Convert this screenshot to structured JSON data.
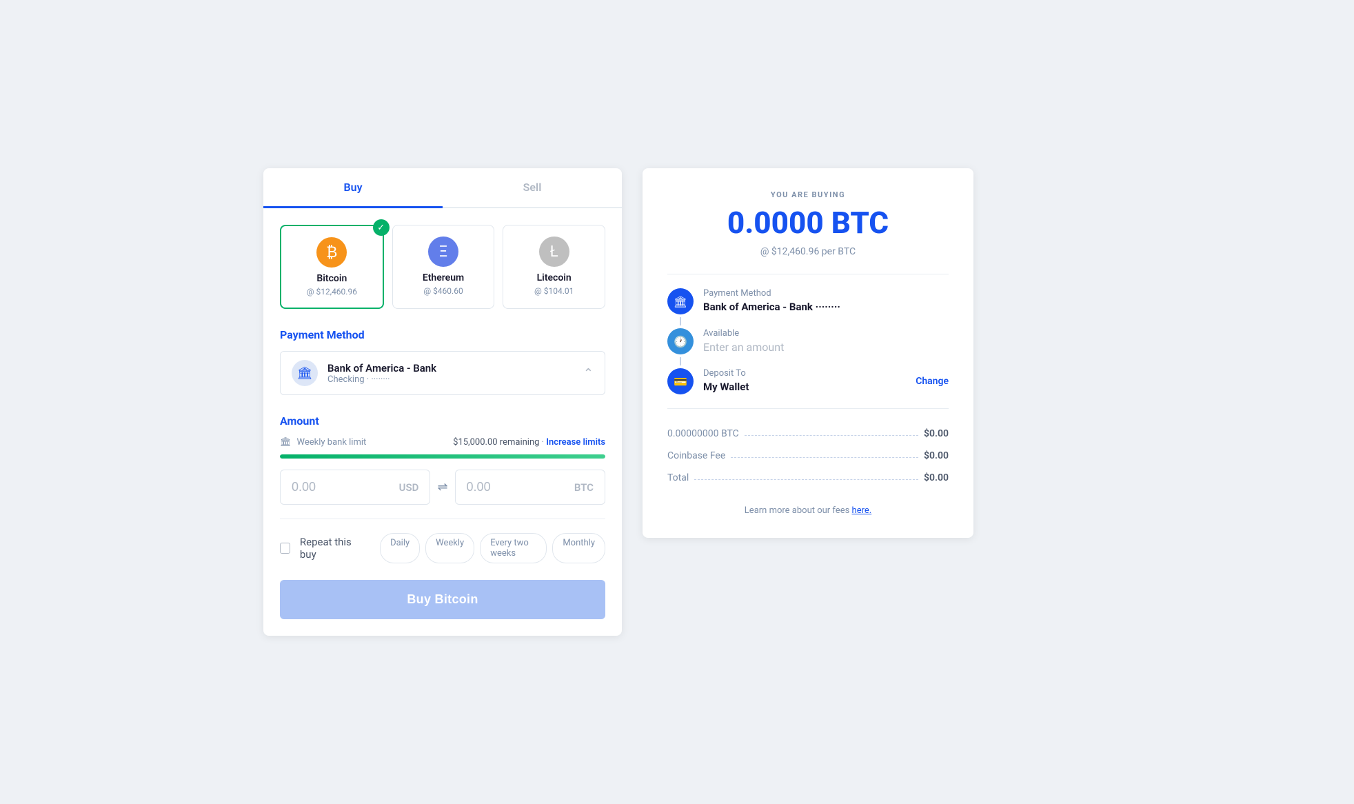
{
  "tabs": {
    "buy": "Buy",
    "sell": "Sell"
  },
  "crypto": {
    "cards": [
      {
        "id": "bitcoin",
        "name": "Bitcoin",
        "price": "@ $12,460.96",
        "selected": true
      },
      {
        "id": "ethereum",
        "name": "Ethereum",
        "price": "@ $460.60",
        "selected": false
      },
      {
        "id": "litecoin",
        "name": "Litecoin",
        "price": "@ $104.01",
        "selected": false
      }
    ]
  },
  "payment_method": {
    "label": "Payment Method",
    "bank_name": "Bank of America - Bank",
    "bank_sub": "Checking · ········"
  },
  "amount": {
    "label": "Amount",
    "limit_label": "Weekly bank limit",
    "limit_remaining": "$15,000.00 remaining",
    "limit_link": "Increase limits",
    "progress_percent": 100,
    "usd_value": "0.00",
    "usd_currency": "USD",
    "btc_value": "0.00",
    "btc_currency": "BTC"
  },
  "repeat": {
    "label": "Repeat this buy",
    "options": [
      "Daily",
      "Weekly",
      "Every two weeks",
      "Monthly"
    ]
  },
  "buy_button": "Buy Bitcoin",
  "right": {
    "you_are_buying": "YOU ARE BUYING",
    "btc_amount": "0.0000 BTC",
    "btc_rate": "@ $12,460.96 per BTC",
    "payment_method_label": "Payment Method",
    "payment_method_value": "Bank of America - Bank ········",
    "available_label": "Available",
    "available_placeholder": "Enter an amount",
    "deposit_label": "Deposit To",
    "deposit_value": "My Wallet",
    "change_link": "Change",
    "summary": [
      {
        "label": "0.00000000 BTC",
        "value": "$0.00",
        "blue": false
      },
      {
        "label": "Coinbase Fee",
        "value": "$0.00",
        "blue": false
      },
      {
        "label": "Total",
        "value": "$0.00",
        "blue": false
      }
    ],
    "learn_more": "Learn more about our fees",
    "learn_more_link": "here."
  }
}
